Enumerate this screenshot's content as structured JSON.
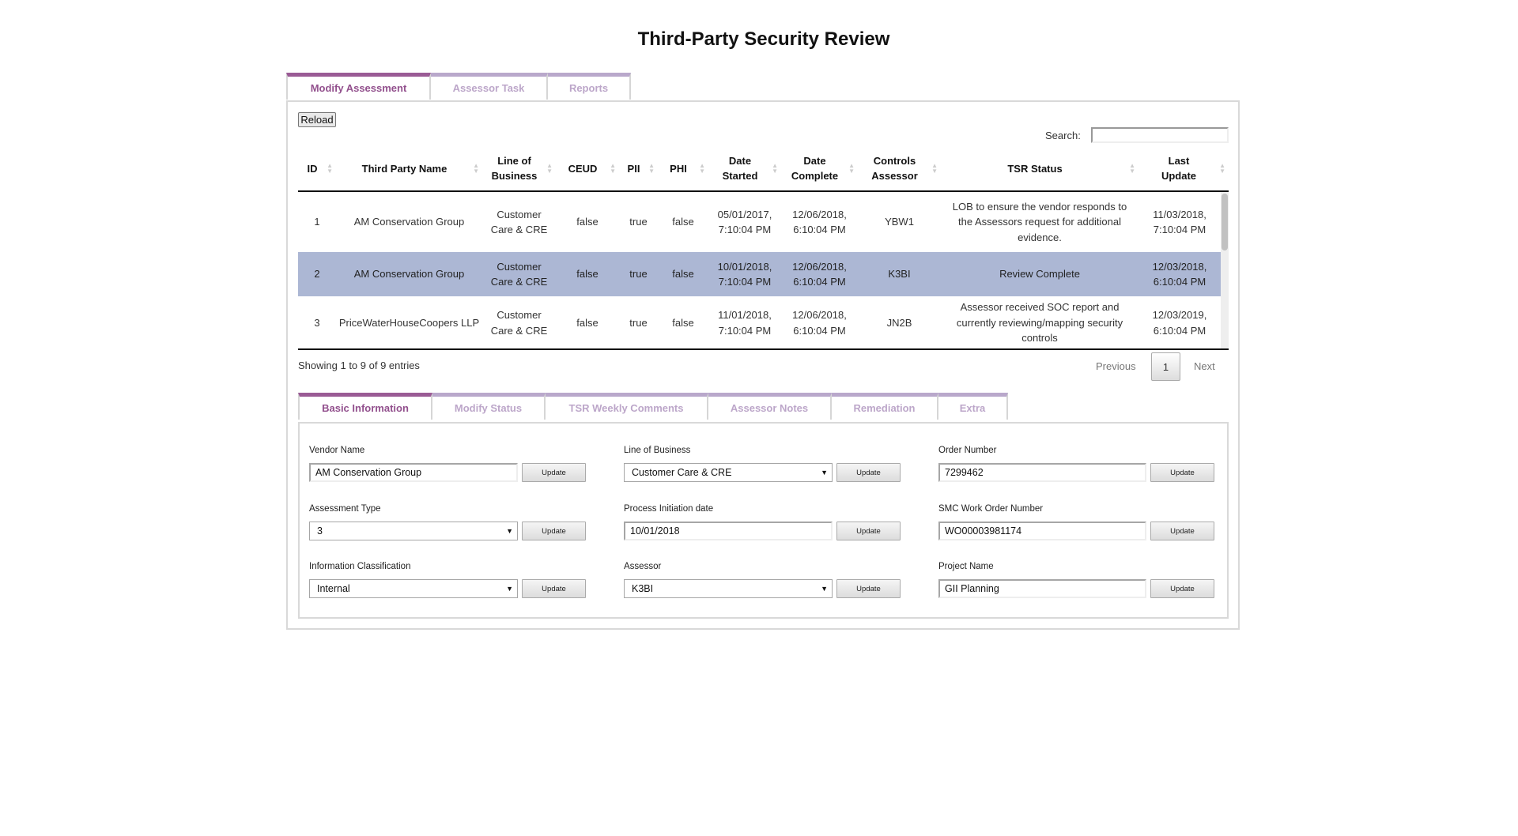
{
  "title": "Third-Party Security Review",
  "outer_tabs": [
    {
      "label": "Modify Assessment",
      "active": true
    },
    {
      "label": "Assessor Task"
    },
    {
      "label": "Reports"
    }
  ],
  "toolbar": {
    "reload": "Reload",
    "search_label": "Search:",
    "search_value": ""
  },
  "table": {
    "headers": [
      "ID",
      "Third Party Name",
      "Line of Business",
      "CEUD",
      "PII",
      "PHI",
      "Date Started",
      "Date Complete",
      "Controls Assessor",
      "TSR Status",
      "Last Update"
    ],
    "rows": [
      {
        "id": "1",
        "name": "AM Conservation Group",
        "lob": "Customer Care & CRE",
        "ceud": "false",
        "pii": "true",
        "phi": "false",
        "started": "05/01/2017, 7:10:04 PM",
        "complete": "12/06/2018, 6:10:04 PM",
        "assessor": "YBW1",
        "status": "LOB to ensure the vendor responds to the Assessors request for additional evidence.",
        "last": "11/03/2018, 7:10:04 PM"
      },
      {
        "id": "2",
        "name": "AM Conservation Group",
        "lob": "Customer Care & CRE",
        "ceud": "false",
        "pii": "true",
        "phi": "false",
        "started": "10/01/2018, 7:10:04 PM",
        "complete": "12/06/2018, 6:10:04 PM",
        "assessor": "K3BI",
        "status": "Review Complete",
        "last": "12/03/2018, 6:10:04 PM",
        "selected": true
      },
      {
        "id": "3",
        "name": "PriceWaterHouseCoopers LLP",
        "lob": "Customer Care & CRE",
        "ceud": "false",
        "pii": "true",
        "phi": "false",
        "started": "11/01/2018, 7:10:04 PM",
        "complete": "12/06/2018, 6:10:04 PM",
        "assessor": "JN2B",
        "status": "Assessor received SOC report and currently reviewing/mapping security controls",
        "last": "12/03/2019, 6:10:04 PM"
      }
    ],
    "selected_row_color": "#acb7d4",
    "info": "Showing 1 to 9 of 9 entries",
    "pagination": {
      "previous": "Previous",
      "page": "1",
      "next": "Next"
    }
  },
  "inner_tabs": [
    {
      "label": "Basic Information",
      "active": true
    },
    {
      "label": "Modify Status"
    },
    {
      "label": "TSR Weekly Comments"
    },
    {
      "label": "Assessor Notes"
    },
    {
      "label": "Remediation"
    },
    {
      "label": "Extra"
    }
  ],
  "form": {
    "update_label": "Update",
    "fields": [
      {
        "label": "Vendor Name",
        "value": "AM Conservation Group",
        "type": "text"
      },
      {
        "label": "Line of Business",
        "value": "Customer Care & CRE",
        "type": "select"
      },
      {
        "label": "Order Number",
        "value": "7299462",
        "type": "text"
      },
      {
        "label": "Assessment Type",
        "value": "3",
        "type": "select"
      },
      {
        "label": "Process Initiation date",
        "value": "10/01/2018",
        "type": "text"
      },
      {
        "label": "SMC Work Order Number",
        "value": "WO00003981174",
        "type": "text"
      },
      {
        "label": "Information Classification",
        "value": "Internal",
        "type": "select"
      },
      {
        "label": "Assessor",
        "value": "K3BI",
        "type": "select"
      },
      {
        "label": "Project Name",
        "value": "GII Planning",
        "type": "text"
      }
    ]
  },
  "colors": {
    "accent": "#9a5b95",
    "inactive_tab": "#bca6c9"
  }
}
